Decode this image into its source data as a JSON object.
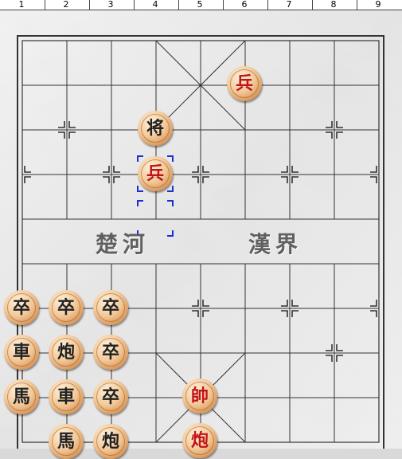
{
  "ruler": {
    "columns": [
      "1",
      "2",
      "3",
      "4",
      "5",
      "6",
      "7",
      "8",
      "9"
    ]
  },
  "river": {
    "left_text": "楚河",
    "right_text": "漢界"
  },
  "colors": {
    "red_piece_text": "#c0141a",
    "black_piece_text": "#222222",
    "selection_marker": "#1a2fd6",
    "grid_line": "#333333"
  },
  "pieces": [
    {
      "label": "兵",
      "side": "red"
    },
    {
      "label": "将",
      "side": "black"
    },
    {
      "label": "兵",
      "side": "red"
    },
    {
      "label": "帥",
      "side": "red"
    },
    {
      "label": "炮",
      "side": "red"
    },
    {
      "label": "卒",
      "side": "black"
    },
    {
      "label": "卒",
      "side": "black"
    },
    {
      "label": "卒",
      "side": "black"
    },
    {
      "label": "車",
      "side": "black"
    },
    {
      "label": "炮",
      "side": "black"
    },
    {
      "label": "卒",
      "side": "black"
    },
    {
      "label": "馬",
      "side": "black"
    },
    {
      "label": "車",
      "side": "black"
    },
    {
      "label": "卒",
      "side": "black"
    },
    {
      "label": "馬",
      "side": "black"
    },
    {
      "label": "炮",
      "side": "black"
    }
  ],
  "selected_piece_index": 2
}
